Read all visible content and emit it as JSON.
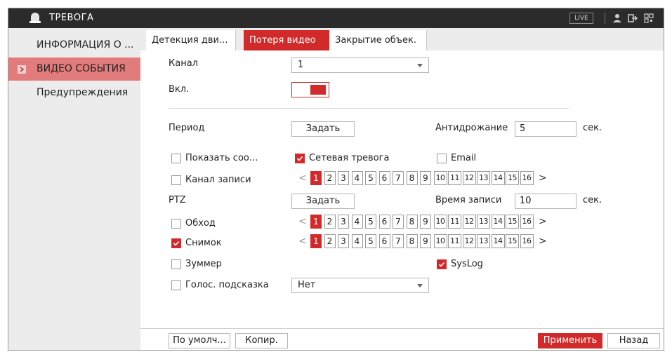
{
  "window": {
    "title": "ТРЕВОГА",
    "live_label": "LIVE"
  },
  "sidebar": {
    "items": [
      {
        "label": "ИНФОРМАЦИЯ О ..."
      },
      {
        "label": "ВИДЕО СОБЫТИЯ",
        "active": true
      },
      {
        "label": "Предупреждения"
      }
    ]
  },
  "tabs": [
    {
      "label": "Детекция дви..."
    },
    {
      "label": "Потеря видео",
      "active": true
    },
    {
      "label": "Закрытие объек."
    }
  ],
  "form": {
    "channel_label": "Канал",
    "channel_value": "1",
    "enable_label": "Вкл.",
    "enable_on": true,
    "period_label": "Период",
    "set_button": "Задать",
    "antidither_label": "Антидрожание",
    "antidither_value": "5",
    "sec_unit": "сек.",
    "show_message_label": "Показать соо...",
    "show_message_checked": false,
    "network_alarm_label": "Сетевая тревога",
    "network_alarm_checked": true,
    "email_label": "Email",
    "email_checked": false,
    "record_channel_label": "Канал записи",
    "record_channel_checked": false,
    "ptz_label": "PTZ",
    "ptz_set_button": "Задать",
    "record_time_label": "Время записи",
    "record_time_value": "10",
    "tour_label": "Обход",
    "tour_checked": false,
    "snapshot_label": "Снимок",
    "snapshot_checked": true,
    "buzzer_label": "Зуммер",
    "buzzer_checked": false,
    "syslog_label": "SysLog",
    "syslog_checked": true,
    "voice_prompt_label": "Голос. подсказка",
    "voice_prompt_checked": false,
    "voice_prompt_value": "Нет",
    "channels": [
      "1",
      "2",
      "3",
      "4",
      "5",
      "6",
      "7",
      "8",
      "9",
      "10",
      "11",
      "12",
      "13",
      "14",
      "15",
      "16"
    ],
    "record_channel_selected": [
      "1"
    ],
    "tour_selected": [
      "1"
    ],
    "snapshot_selected": [
      "1"
    ]
  },
  "footer": {
    "default_button": "По умолч...",
    "copy_button": "Копир.",
    "apply_button": "Применить",
    "back_button": "Назад"
  },
  "colors": {
    "accent": "#d22a2a",
    "sidebar_active": "#e27b7b",
    "titlebar": "#2b2b2b"
  },
  "icons": [
    "alarm-bell-icon",
    "user-icon",
    "logout-icon",
    "qr-icon",
    "chevron-right-icon",
    "chevron-left-icon",
    "dropdown-arrow-icon",
    "checkmark-icon"
  ]
}
